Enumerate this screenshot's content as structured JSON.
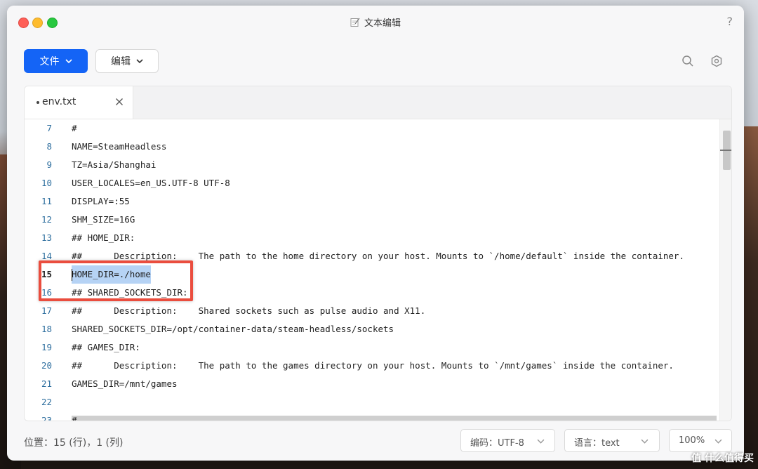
{
  "window": {
    "title": "文本编辑"
  },
  "toolbar": {
    "file_label": "文件",
    "edit_label": "编辑"
  },
  "tabs": [
    {
      "label": "env.txt"
    }
  ],
  "editor": {
    "lines": [
      {
        "n": "7",
        "text": "#"
      },
      {
        "n": "8",
        "text": "NAME=SteamHeadless"
      },
      {
        "n": "9",
        "text": "TZ=Asia/Shanghai"
      },
      {
        "n": "10",
        "text": "USER_LOCALES=en_US.UTF-8 UTF-8"
      },
      {
        "n": "11",
        "text": "DISPLAY=:55"
      },
      {
        "n": "12",
        "text": "SHM_SIZE=16G"
      },
      {
        "n": "13",
        "text": "## HOME_DIR:"
      },
      {
        "n": "14",
        "text": "##      Description:    The path to the home directory on your host. Mounts to `/home/default` inside the container."
      },
      {
        "n": "15",
        "text": "HOME_DIR=./home"
      },
      {
        "n": "16",
        "text": "## SHARED_SOCKETS_DIR:"
      },
      {
        "n": "17",
        "text": "##      Description:    Shared sockets such as pulse audio and X11."
      },
      {
        "n": "18",
        "text": "SHARED_SOCKETS_DIR=/opt/container-data/steam-headless/sockets"
      },
      {
        "n": "19",
        "text": "## GAMES_DIR:"
      },
      {
        "n": "20",
        "text": "##      Description:    The path to the games directory on your host. Mounts to `/mnt/games` inside the container."
      },
      {
        "n": "21",
        "text": "GAMES_DIR=/mnt/games"
      },
      {
        "n": "22",
        "text": ""
      },
      {
        "n": "23",
        "text": "#"
      }
    ]
  },
  "status": {
    "position": "位置：15 (行)，1 (列)",
    "encoding": "编码：UTF-8",
    "language": "语言：text",
    "zoom": "100%"
  },
  "watermark": "值 什么值得买",
  "colors": {
    "primary": "#1464f6",
    "highlight": "#ea4d3e",
    "selection": "#b6d3f5"
  }
}
